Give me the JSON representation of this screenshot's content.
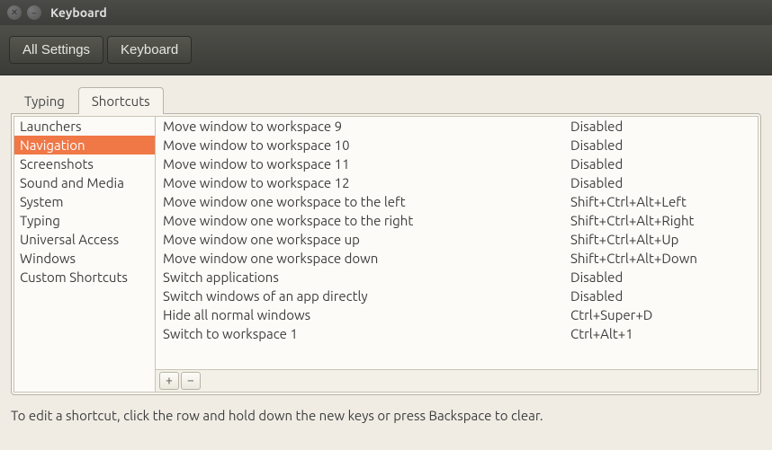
{
  "window": {
    "title": "Keyboard"
  },
  "toolbar": {
    "all_settings": "All Settings",
    "keyboard": "Keyboard"
  },
  "tabs": {
    "typing": "Typing",
    "shortcuts": "Shortcuts"
  },
  "sidebar": {
    "items": [
      {
        "label": "Launchers"
      },
      {
        "label": "Navigation"
      },
      {
        "label": "Screenshots"
      },
      {
        "label": "Sound and Media"
      },
      {
        "label": "System"
      },
      {
        "label": "Typing"
      },
      {
        "label": "Universal Access"
      },
      {
        "label": "Windows"
      },
      {
        "label": "Custom Shortcuts"
      }
    ],
    "selected_index": 1
  },
  "shortcuts": [
    {
      "action": "Move window to workspace 9",
      "key": "Disabled"
    },
    {
      "action": "Move window to workspace 10",
      "key": "Disabled"
    },
    {
      "action": "Move window to workspace 11",
      "key": "Disabled"
    },
    {
      "action": "Move window to workspace 12",
      "key": "Disabled"
    },
    {
      "action": "Move window one workspace to the left",
      "key": "Shift+Ctrl+Alt+Left"
    },
    {
      "action": "Move window one workspace to the right",
      "key": "Shift+Ctrl+Alt+Right"
    },
    {
      "action": "Move window one workspace up",
      "key": "Shift+Ctrl+Alt+Up"
    },
    {
      "action": "Move window one workspace down",
      "key": "Shift+Ctrl+Alt+Down"
    },
    {
      "action": "Switch applications",
      "key": "Disabled"
    },
    {
      "action": "Switch windows of an app directly",
      "key": "Disabled"
    },
    {
      "action": "Hide all normal windows",
      "key": "Ctrl+Super+D"
    },
    {
      "action": "Switch to workspace 1",
      "key": "Ctrl+Alt+1"
    }
  ],
  "buttons": {
    "add": "+",
    "remove": "−"
  },
  "hint": "To edit a shortcut, click the row and hold down the new keys or press Backspace to clear."
}
